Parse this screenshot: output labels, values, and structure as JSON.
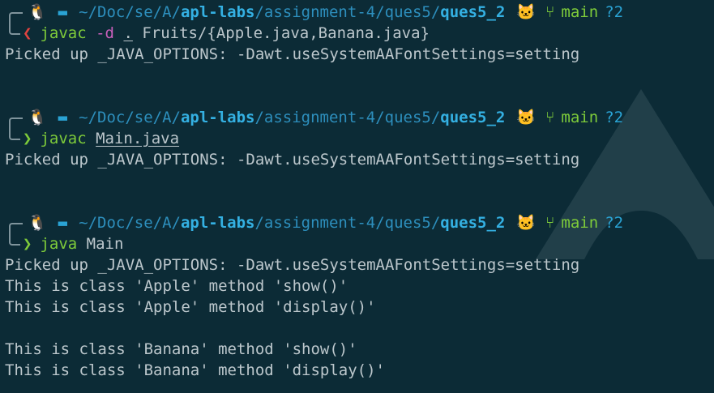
{
  "prompt": {
    "os_icon": "linux-icon",
    "folder_icon": "folder-icon",
    "path_prefix_dim": "~/Doc/se/A/",
    "path_repo": "apl-labs",
    "path_mid_dim": "/assignment-4/ques5/",
    "path_current": "ques5_2",
    "git_icon": "github-icon",
    "branch_icon": "git-branch-icon",
    "branch": "main",
    "status": "?2"
  },
  "blocks": [
    {
      "arrow": "❮",
      "arrow_state": "error",
      "command": [
        "javac",
        " ",
        "-d",
        " ",
        ".",
        " Fruits/{Apple.java,Banana.java}"
      ],
      "output": [
        "Picked up _JAVA_OPTIONS: -Dawt.useSystemAAFontSettings=setting"
      ]
    },
    {
      "arrow": "❯",
      "arrow_state": "ok",
      "command": [
        "javac",
        " ",
        "Main.java"
      ],
      "output": [
        "Picked up _JAVA_OPTIONS: -Dawt.useSystemAAFontSettings=setting"
      ]
    },
    {
      "arrow": "❯",
      "arrow_state": "ok",
      "command": [
        "java",
        " ",
        "Main"
      ],
      "output": [
        "Picked up _JAVA_OPTIONS: -Dawt.useSystemAAFontSettings=setting",
        "This is class 'Apple' method 'show()'",
        "This is class 'Apple' method 'display()'",
        "",
        "This is class 'Banana' method 'show()'",
        "This is class 'Banana' method 'display()'"
      ]
    }
  ],
  "colors": {
    "background": "#0c2b36",
    "path": "#2d8fbd",
    "path_bold": "#34b0e2",
    "git": "#7ecb3a",
    "error_arrow": "#e0433f",
    "flag": "#c85fbb",
    "text": "#bcc7cc"
  }
}
